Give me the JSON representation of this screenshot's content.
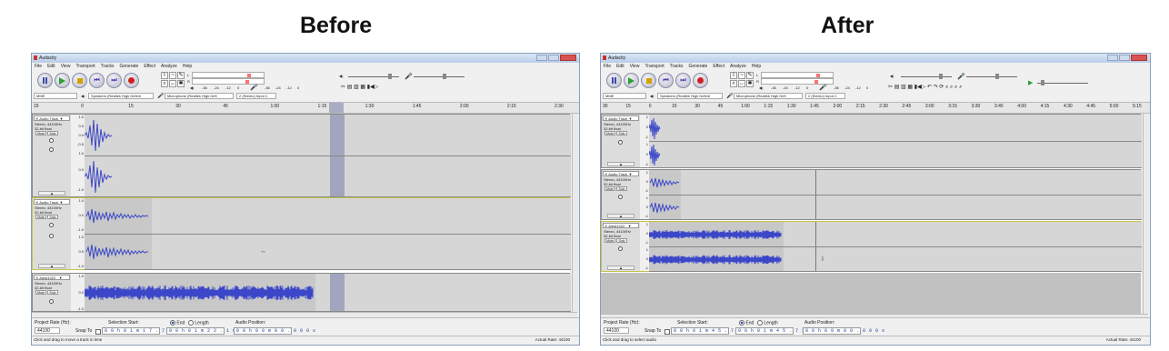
{
  "headings": {
    "before": "Before",
    "after": "After"
  },
  "app": {
    "title": "Audacity",
    "menu": [
      "File",
      "Edit",
      "View",
      "Transport",
      "Tracks",
      "Generate",
      "Effect",
      "Analyze",
      "Help"
    ],
    "meter_labels": {
      "left": "L",
      "right": "R"
    },
    "meter_ticks": [
      "-36",
      "-24",
      "-12",
      "0"
    ],
    "device": {
      "host": "MME",
      "output": "Speakers (Realtek High Definit",
      "input": "Microphone (Realtek High Defi",
      "channels": "2 (Stereo) Input C"
    },
    "track_ui": {
      "mute": "Mute",
      "solo": "Solo",
      "collapse": "▲"
    },
    "bottom": {
      "project_rate_label": "Project Rate (Hz):",
      "project_rate": "44100",
      "snap_to": "Snap To",
      "selection_start": "Selection Start:",
      "end": "End",
      "length": "Length",
      "audio_position": "Audio Position:"
    },
    "actual_rate": "Actual Rate: 44100"
  },
  "before": {
    "ruler_ticks": [
      "15",
      "0",
      "15",
      "30",
      "45",
      "1:00",
      "1:15",
      "1:30",
      "1:45",
      "2:00",
      "2:15",
      "2:30"
    ],
    "tracks": [
      {
        "name": "Audio Track",
        "info1": "Stereo, 44100Hz",
        "info2": "32-bit float",
        "scale": [
          "1.0",
          "0.5",
          "0.0",
          "-0.5",
          "-1.0"
        ]
      },
      {
        "name": "Audio Track",
        "info1": "Stereo, 44100Hz",
        "info2": "32-bit float",
        "scale": [
          "1.0",
          "0.0",
          "-1.0"
        ]
      },
      {
        "name": "Artist1022_",
        "info1": "Stereo, 44100Hz",
        "info2": "32-bit float",
        "scale": [
          "1.0",
          "0.0",
          "-1.0"
        ]
      }
    ],
    "selection_start": "0 0 h 0 1 m 1 7 . 7 0 6 s",
    "selection_end": "0 0 h 0 1 m 2 2 . 1 6 5 s",
    "audio_position": "0 0 h 0 0 m 0 0 . 0 0 0 s",
    "status": "Click and drag to move a track in time"
  },
  "after": {
    "ruler_ticks": [
      "30",
      "15",
      "0",
      "15",
      "30",
      "45",
      "1:00",
      "1:15",
      "1:30",
      "1:45",
      "2:00",
      "2:15",
      "2:30",
      "2:45",
      "3:00",
      "3:15",
      "3:30",
      "3:45",
      "4:00",
      "4:15",
      "4:30",
      "4:45",
      "5:00",
      "5:15"
    ],
    "tracks": [
      {
        "name": "Audio Track",
        "info1": "Stereo, 44100Hz",
        "info2": "32-bit float",
        "scale": [
          "1",
          "0",
          "-1"
        ]
      },
      {
        "name": "Audio Track",
        "info1": "Stereo, 44100Hz",
        "info2": "32-bit float",
        "scale": [
          "1",
          "0",
          "-1"
        ]
      },
      {
        "name": "Artist1022_",
        "info1": "Stereo, 44100Hz",
        "info2": "32-bit float",
        "scale": [
          "1",
          "0",
          "-1"
        ]
      }
    ],
    "selection_start": "0 0 h 0 1 m 4 5 . 7 3 1 s",
    "selection_end": "0 0 h 0 1 m 4 5 . 7 3 1 s",
    "audio_position": "0 0 h 0 0 m 0 0 . 0 0 0 s",
    "status": "Click and drag to select audio"
  }
}
